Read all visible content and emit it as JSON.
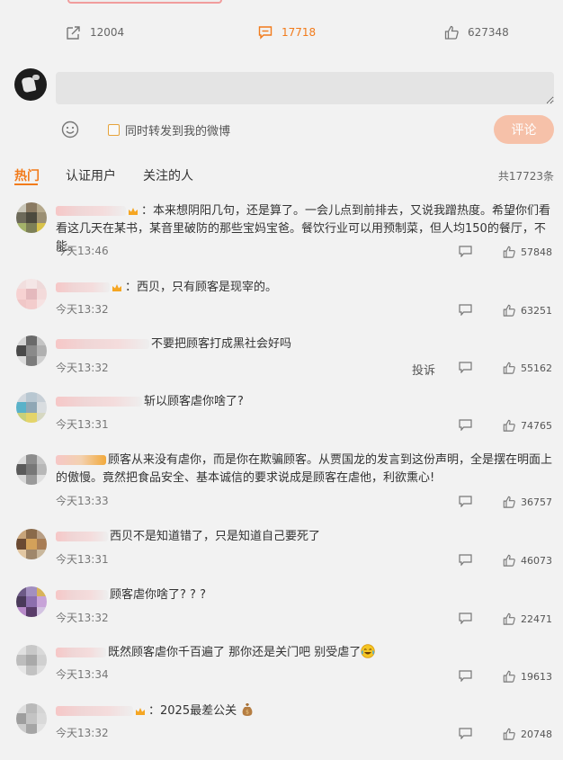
{
  "post_actions": {
    "forward_count": "12004",
    "comment_count": "17718",
    "like_count": "627348"
  },
  "composer": {
    "input_placeholder": "",
    "forward_option_label": "同时转发到我的微博",
    "submit_label": "评论"
  },
  "tabs": [
    {
      "label": "热门"
    },
    {
      "label": "认证用户"
    },
    {
      "label": "关注的人"
    }
  ],
  "total_label": "共17723条",
  "comments": [
    {
      "text": "：本来想阴阳几句，还是算了。一会儿点到前排去，又说我蹭热度。希望你们看看这几天在某书，某音里破防的那些宝妈宝爸。餐饮行业可以用预制菜，但人均150的餐厅，不能。",
      "time": "今天13:46",
      "likes": "57848",
      "report": ""
    },
    {
      "text": "：西贝，只有顾客是现宰的。",
      "time": "今天13:32",
      "likes": "63251",
      "report": ""
    },
    {
      "text": "不要把顾客打成黑社会好吗",
      "time": "今天13:32",
      "likes": "55162",
      "report": "投诉"
    },
    {
      "text": "斩以顾客虐你啥了?",
      "time": "今天13:31",
      "likes": "74765",
      "report": ""
    },
    {
      "text": "顾客从来没有虐你，而是你在欺骗顾客。从贾国龙的发言到这份声明，全是摆在明面上的傲慢。竟然把食品安全、基本诚信的要求说成是顾客在虐他，利欲熏心!",
      "time": "今天13:33",
      "likes": "36757",
      "report": ""
    },
    {
      "text": "西贝不是知道错了，只是知道自己要死了",
      "time": "今天13:31",
      "likes": "46073",
      "report": ""
    },
    {
      "text": "顾客虐你啥了? ? ?",
      "time": "今天13:32",
      "likes": "22471",
      "report": ""
    },
    {
      "text": "既然顾客虐你千百遍了 那你还是关门吧 别受虐了",
      "time": "今天13:34",
      "likes": "19613",
      "report": ""
    },
    {
      "text": "：2025最差公关",
      "time": "今天13:32",
      "likes": "20748",
      "report": ""
    }
  ],
  "colors": {
    "accent": "#f27b1b",
    "submit_bg": "#f6c1a9",
    "background": "#f2f2f2"
  }
}
